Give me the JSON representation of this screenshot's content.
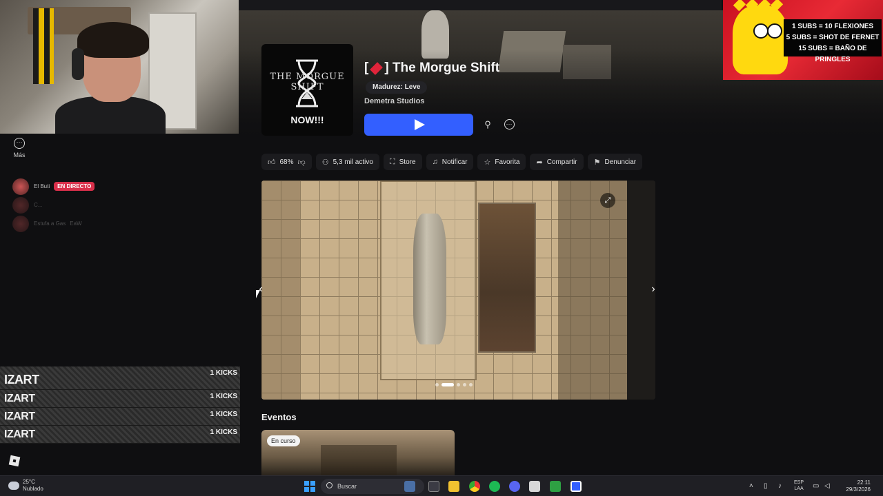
{
  "sidebar": {
    "more_label": "Más",
    "friends": [
      {
        "name": "El Buti",
        "status": "EN DIRECTO"
      },
      {
        "name": "C...",
        "status": ""
      },
      {
        "name": "Estufa a Gas",
        "status": "EaW"
      }
    ]
  },
  "kicks": [
    {
      "name": "IZART",
      "value": "1 KICKS"
    },
    {
      "name": "IZART",
      "value": "1 KICKS"
    },
    {
      "name": "IZART",
      "value": "1 KICKS"
    },
    {
      "name": "IZART",
      "value": "1 KICKS"
    }
  ],
  "overlay": {
    "lines": [
      "1 SUBS = 10 FLEXIONES",
      "5 SUBS = SHOT DE FERNET",
      "15 SUBS = BAÑO DE PRINGLES"
    ]
  },
  "game": {
    "thumbnail_text_top": "THE MORGUE SHIFT",
    "thumbnail_text_bottom": "NOW!!!",
    "title_prefix": "[",
    "title_suffix": "] The Morgue Shift",
    "maturity": "Madurez: Leve",
    "studio": "Demetra Studios",
    "accent_color": "#335fff"
  },
  "chips": {
    "rating": "68%",
    "active": "5,3 mil activo",
    "store": "Store",
    "notify": "Notificar",
    "favorite": "Favorita",
    "share": "Compartir",
    "report": "Denunciar"
  },
  "carousel": {
    "slides": 5,
    "active_slide": 2
  },
  "events": {
    "title": "Eventos",
    "card_badge": "En curso"
  },
  "taskbar": {
    "temperature": "25°C",
    "weather": "Nublado",
    "search_placeholder": "Buscar",
    "lang_top": "ESP",
    "lang_bottom": "LAA",
    "time": "22:11",
    "date": "29/3/2026"
  }
}
